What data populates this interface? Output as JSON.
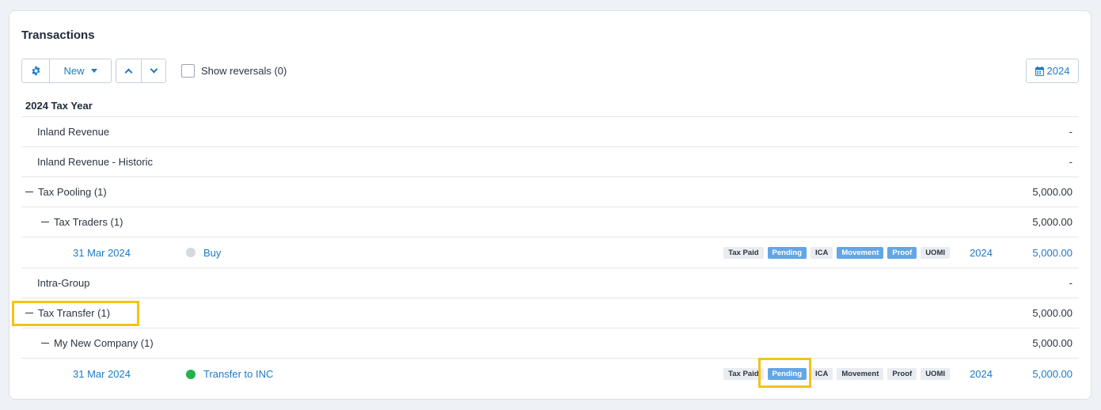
{
  "panel": {
    "title": "Transactions"
  },
  "toolbar": {
    "gear_icon": "gear-icon",
    "new_label": "New",
    "show_reversals_label": "Show reversals (0)",
    "year_label": "2024",
    "calendar_icon": "calendar-icon"
  },
  "section": {
    "heading": "2024 Tax Year"
  },
  "rows": [
    {
      "label": "Inland Revenue",
      "amount": "-"
    },
    {
      "label": "Inland Revenue - Historic",
      "amount": "-"
    },
    {
      "label": "Tax Pooling (1)",
      "amount": "5,000.00"
    },
    {
      "label": "Tax Traders (1)",
      "amount": "5,000.00"
    },
    {
      "label": "Intra-Group",
      "amount": "-"
    },
    {
      "label": "Tax Transfer (1)",
      "amount": "5,000.00"
    },
    {
      "label": "My New Company (1)",
      "amount": "5,000.00"
    }
  ],
  "transactions": [
    {
      "date": "31 Mar 2024",
      "name": "Buy",
      "status_color": "#d5d8dc",
      "tags": [
        "Tax Paid",
        "Pending",
        "ICA",
        "Movement",
        "Proof",
        "UOMI"
      ],
      "year": "2024",
      "amount": "5,000.00"
    },
    {
      "date": "31 Mar 2024",
      "name": "Transfer to INC",
      "status_color": "#22b24c",
      "tags": [
        "Tax Paid",
        "Pending",
        "ICA",
        "Movement",
        "Proof",
        "UOMI"
      ],
      "year": "2024",
      "amount": "5,000.00"
    }
  ],
  "colors": {
    "accent": "#1f7ac7",
    "highlight": "#f3c317",
    "tag_blue": "#63a6e6"
  }
}
